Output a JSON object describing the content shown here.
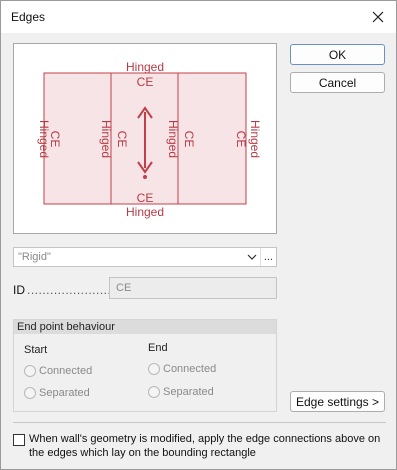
{
  "window": {
    "title": "Edges"
  },
  "preview": {
    "top": {
      "type": "Hinged",
      "code": "CE"
    },
    "bottom": {
      "type": "Hinged",
      "code": "CE"
    },
    "left": {
      "type": "Hinged",
      "code": "CE"
    },
    "mid_left": {
      "type": "Hinged",
      "code": "CE"
    },
    "mid_right": {
      "type": "Hinged",
      "code": "CE"
    },
    "right": {
      "type": "Hinged",
      "code": "CE"
    },
    "colors": {
      "stroke": "#c0404a",
      "fill": "#f7e4e6",
      "text": "#b83a44"
    }
  },
  "buttons": {
    "ok": "OK",
    "cancel": "Cancel",
    "edge_settings": "Edge settings >"
  },
  "combo": {
    "value": "\"Rigid\"",
    "more": "..."
  },
  "id": {
    "label": "ID",
    "dots": "......................",
    "value": "CE"
  },
  "end_point": {
    "title": "End point behaviour",
    "start": {
      "label": "Start",
      "connected": "Connected",
      "separated": "Separated"
    },
    "end": {
      "label": "End",
      "connected": "Connected",
      "separated": "Separated"
    }
  },
  "footer": {
    "checkbox_label": "When wall's geometry is modified, apply the edge connections above on the edges which lay on the bounding rectangle"
  }
}
